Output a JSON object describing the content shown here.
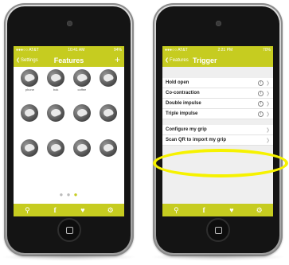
{
  "left_phone": {
    "status": {
      "carrier": "●●●○○ AT&T",
      "time": "10:41 AM",
      "battery": "94%"
    },
    "nav": {
      "back_label": "Settings",
      "title": "Features",
      "add_symbol": "+"
    },
    "grid_items": [
      {
        "label": "phone"
      },
      {
        "label": "bok"
      },
      {
        "label": "coffee"
      },
      {
        "label": ""
      },
      {
        "label": ""
      },
      {
        "label": ""
      },
      {
        "label": ""
      },
      {
        "label": ""
      },
      {
        "label": ""
      },
      {
        "label": ""
      },
      {
        "label": ""
      },
      {
        "label": ""
      }
    ],
    "pager": {
      "current": 3,
      "total": 3
    }
  },
  "right_phone": {
    "status": {
      "carrier": "●●●○○ AT&T",
      "time": "2:21 PM",
      "battery": "70%"
    },
    "nav": {
      "back_label": "Features",
      "title": "Trigger"
    },
    "list_group_1": [
      {
        "label": "Hold open"
      },
      {
        "label": "Co-contraction"
      },
      {
        "label": "Double impulse"
      },
      {
        "label": "Triple impulse"
      }
    ],
    "list_group_2": [
      {
        "label": "Configure my grip"
      },
      {
        "label": "Scan QR to import my grip"
      }
    ]
  },
  "tab_icons": [
    "search-icon",
    "facebook-icon",
    "heart-icon",
    "gear-icon"
  ],
  "colors": {
    "accent": "#c6cc20",
    "highlight": "#f6f200"
  }
}
